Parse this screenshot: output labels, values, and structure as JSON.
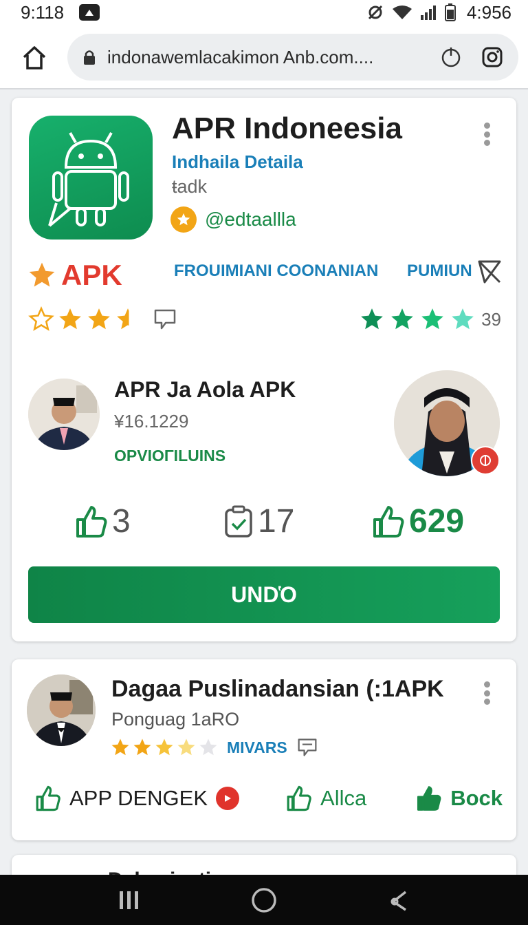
{
  "status": {
    "time": "9:118",
    "clock": "4:956"
  },
  "browser": {
    "url": "indonawemlacakimon Anb.com...."
  },
  "app": {
    "title": "APR Indoneesia",
    "subtitle": "Indhaila Detaila",
    "tag": "ŧadk",
    "developer": "@edtaallla",
    "apk_label": "APK",
    "link_a": "FROUIMIANI COONANIAN",
    "link_b": "PUMIUN",
    "rating_left": 3.5,
    "rating_right": 4.5,
    "rating_count": "39",
    "colors": {
      "green": "#1a8a47",
      "blue": "#1a7fb8",
      "red": "#e23a2e",
      "star": "#f2a516"
    }
  },
  "feature": {
    "title": "APR Ja Aola APK",
    "price": "¥16.1229",
    "tag": "OPVIOΓILUINS"
  },
  "stats": [
    {
      "icon": "thumbs-up-icon",
      "value": "3"
    },
    {
      "icon": "clipboard-check-icon",
      "value": "17"
    },
    {
      "icon": "thumbs-up-icon",
      "value": "629"
    }
  ],
  "install": {
    "label": "UNDὉ"
  },
  "card2": {
    "title": "Dagaa Puslinadansian (:1APK",
    "subtitle": "Ponguag 1aRO",
    "rating": 3.5,
    "rating_label": "MIVARS",
    "actions": [
      "APP DENGEK",
      "Allca",
      "Bock"
    ]
  },
  "card3": {
    "title": "Dabaaisatian"
  }
}
